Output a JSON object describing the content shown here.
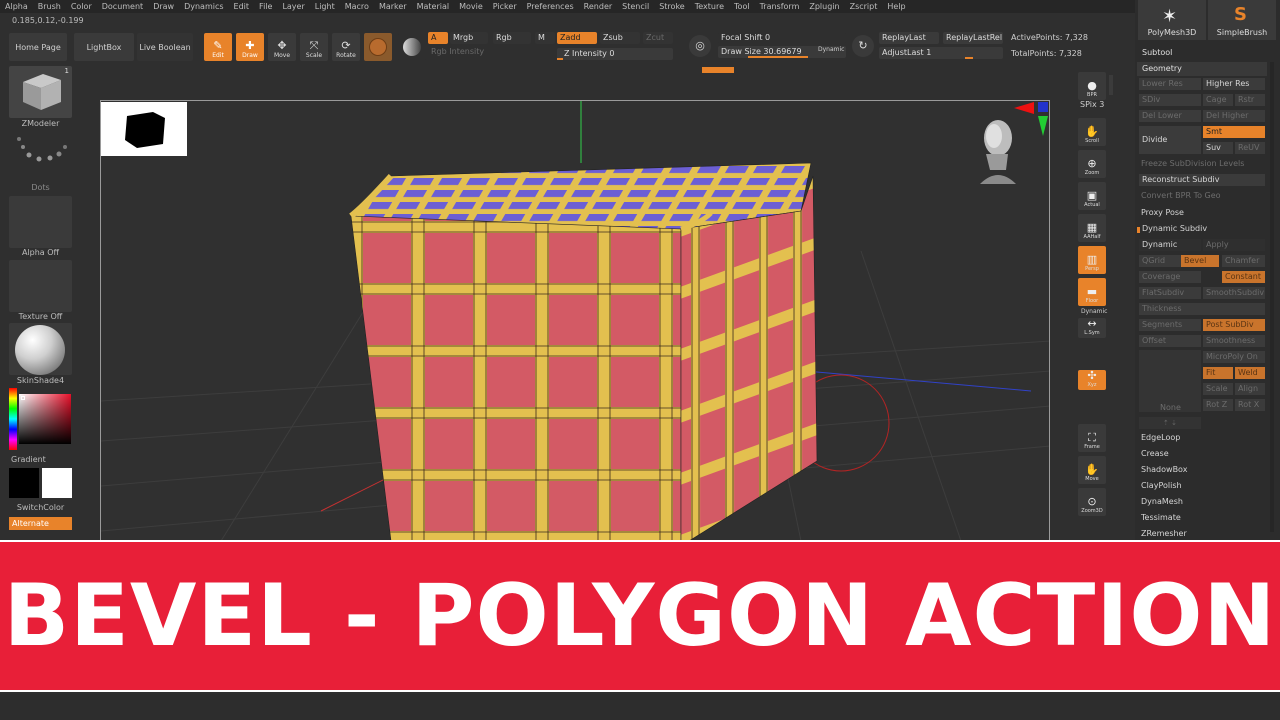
{
  "menu": [
    "Alpha",
    "Brush",
    "Color",
    "Document",
    "Draw",
    "Dynamics",
    "Edit",
    "File",
    "Layer",
    "Light",
    "Macro",
    "Marker",
    "Material",
    "Movie",
    "Picker",
    "Preferences",
    "Render",
    "Stencil",
    "Stroke",
    "Texture",
    "Tool",
    "Transform",
    "Zplugin",
    "Zscript",
    "Help"
  ],
  "coords": "0.185,0.12,-0.199",
  "toolbar": {
    "home_page": "Home Page",
    "lightbox": "LightBox",
    "live_boolean": "Live Boolean",
    "tools": [
      {
        "label": "Edit",
        "icon": "edit-icon",
        "active": true
      },
      {
        "label": "Draw",
        "icon": "draw-icon",
        "active": true
      },
      {
        "label": "Move",
        "icon": "move-icon",
        "active": false
      },
      {
        "label": "Scale",
        "icon": "scale-icon",
        "active": false
      },
      {
        "label": "Rotate",
        "icon": "rotate-icon",
        "active": false
      }
    ],
    "a": "A",
    "mrgb": "Mrgb",
    "rgb": "Rgb",
    "m": "M",
    "rgb_intensity": "Rgb Intensity",
    "zadd": "Zadd",
    "zsub": "Zsub",
    "zcut": "Zcut",
    "z_intensity": "Z Intensity 0",
    "focal_shift": "Focal Shift 0",
    "draw_size": "Draw Size 30.69679",
    "dynamic": "Dynamic",
    "replay_last": "ReplayLast",
    "replay_last_rel": "ReplayLastRel",
    "adjust_last": "AdjustLast 1",
    "active_points": "ActivePoints: 7,328",
    "total_points": "TotalPoints: 7,328"
  },
  "left_shelf": {
    "zmodeler": "ZModeler",
    "zmodeler_badge": "1",
    "dots": "Dots",
    "alpha": "Alpha Off",
    "texture": "Texture Off",
    "material": "SkinShade4",
    "gradient": "Gradient",
    "switch_color": "SwitchColor",
    "alternate": "Alternate"
  },
  "right_shelf": [
    {
      "label": "BPR",
      "icon": "bpr-sphere-icon",
      "active": false
    },
    {
      "label": "Scroll",
      "icon": "scroll-icon",
      "active": false
    },
    {
      "label": "Zoom",
      "icon": "zoom-icon",
      "active": false
    },
    {
      "label": "Actual",
      "icon": "actual-icon",
      "active": false
    },
    {
      "label": "AAHalf",
      "icon": "aahalf-icon",
      "active": false
    },
    {
      "label": "Persp",
      "icon": "persp-icon",
      "active": true
    },
    {
      "label": "Floor",
      "icon": "floor-icon",
      "active": true
    },
    {
      "label": "L.Sym",
      "icon": "lsym-icon",
      "active": false
    },
    {
      "label": "Xyz",
      "icon": "xyz-icon",
      "active": true
    },
    {
      "label": "Frame",
      "icon": "frame-icon",
      "active": false
    },
    {
      "label": "Move",
      "icon": "move-hand-icon",
      "active": false
    },
    {
      "label": "Zoom3D",
      "icon": "zoom3d-icon",
      "active": false
    }
  ],
  "spix": "SPix 3",
  "dynamic_label": "Dynamic",
  "right_panel": {
    "brush_polymesh": "PolyMesh3D",
    "brush_simple": "SimpleBrush",
    "subtool": "Subtool",
    "geometry": "Geometry",
    "lower_res": "Lower Res",
    "higher_res": "Higher Res",
    "sdiv": "SDiv",
    "cage": "Cage",
    "rstr": "Rstr",
    "del_lower": "Del Lower",
    "del_higher": "Del Higher",
    "divide": "Divide",
    "smt": "Smt",
    "suv": "Suv",
    "reuv": "ReUV",
    "freeze": "Freeze SubDivision Levels",
    "reconstruct": "Reconstruct Subdiv",
    "convert_bpr": "Convert BPR To Geo",
    "proxy_pose": "Proxy Pose",
    "dynamic_subdiv": "Dynamic Subdiv",
    "dynamic": "Dynamic",
    "apply": "Apply",
    "qgrid": "QGrid",
    "chamfer": "Chamfer",
    "bevel": "Bevel",
    "coverage": "Coverage",
    "constant": "Constant",
    "flat_subdiv": "FlatSubdiv",
    "smooth_subdiv": "SmoothSubdiv",
    "thickness": "Thickness",
    "segments": "Segments",
    "post_subdiv": "Post SubDiv",
    "offset": "Offset",
    "smoothness": "Smoothness",
    "micropoly": "MicroPoly On",
    "fit": "Fit",
    "weld": "Weld",
    "scale": "Scale",
    "align": "Align",
    "none": "None",
    "rot_z": "Rot Z",
    "rot_x": "Rot X",
    "edgeloop": "EdgeLoop",
    "crease": "Crease",
    "shadowbox": "ShadowBox",
    "claypolish": "ClayPolish",
    "dynamesh": "DynaMesh",
    "tessimate": "Tessimate",
    "zremesher": "ZRemesher"
  },
  "banner": "BEVEL - POLYGON ACTION",
  "colors": {
    "accent": "#e8832a",
    "banner": "#e81f38",
    "cube_face": "#d35a65",
    "cube_strip": "#e3c04f",
    "cube_top": "#6c5fd4"
  }
}
